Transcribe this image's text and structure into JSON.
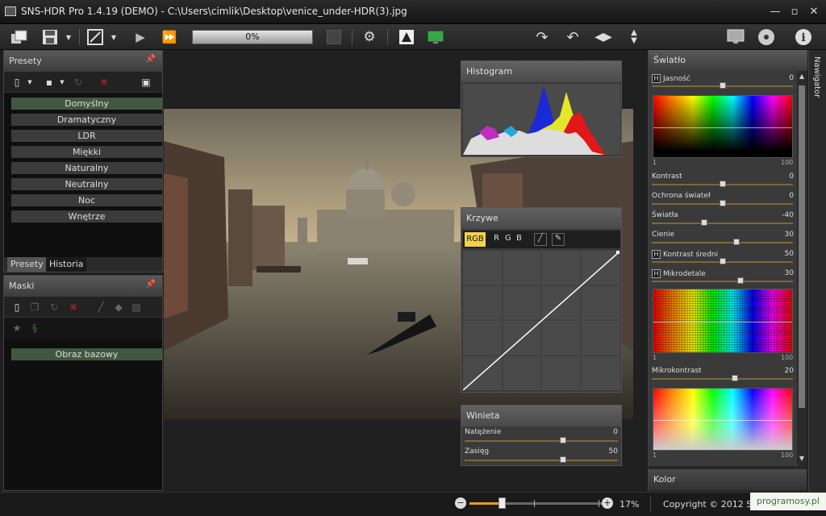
{
  "window": {
    "title": "SNS-HDR Pro 1.4.19 (DEMO) - C:\\Users\\cimlik\\Desktop\\venice_under-HDR(3).jpg"
  },
  "toolbar": {
    "progress": "0%"
  },
  "presets": {
    "title": "Presety",
    "items": [
      "Domyślny",
      "Dramatyczny",
      "LDR",
      "Miękki",
      "Naturalny",
      "Neutralny",
      "Noc",
      "Wnętrze"
    ],
    "tabs": [
      "Presety",
      "Historia"
    ]
  },
  "masks": {
    "title": "Maski",
    "base": "Obraz bazowy"
  },
  "histogram": {
    "title": "Histogram"
  },
  "curves": {
    "title": "Krzywe",
    "channels": [
      "RGB",
      "R",
      "G",
      "B"
    ]
  },
  "vignette": {
    "title": "Winieta",
    "sliders": [
      {
        "label": "Natężenie",
        "value": "0",
        "level": 0.64
      },
      {
        "label": "Zasięg",
        "value": "50",
        "level": 0.64
      }
    ]
  },
  "light": {
    "title": "Światło",
    "sliders": [
      {
        "label": "Jasność",
        "value": "0",
        "h": true,
        "level": 0.5
      },
      {
        "label": "Kontrast",
        "value": "0",
        "level": 0.5
      },
      {
        "label": "Ochrona świateł",
        "value": "0",
        "level": 0.5
      },
      {
        "label": "Światła",
        "value": "-40",
        "level": 0.37
      },
      {
        "label": "Cienie",
        "value": "30",
        "level": 0.6
      },
      {
        "label": "Kontrast średni",
        "value": "50",
        "h": true,
        "level": 0.5
      },
      {
        "label": "Mikrodetale",
        "value": "30",
        "h": true,
        "level": 0.63
      },
      {
        "label": "Mikrokontrast",
        "value": "20",
        "level": 0.59
      }
    ],
    "axis_min": "1",
    "axis_max": "100"
  },
  "color": {
    "title": "Kolor"
  },
  "navigator": {
    "label": "Nawigator"
  },
  "status": {
    "zoom": "17%",
    "copyright": "Copyright © 2012 Seba",
    "watermark": "programosy.pl"
  },
  "colors": {
    "accent": "#405840",
    "highlight": "#f2d24a"
  }
}
